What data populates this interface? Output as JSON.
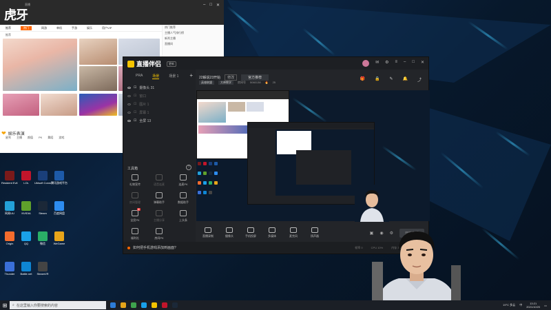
{
  "browser": {
    "logo_text": "虎牙",
    "logo_sub": "直播",
    "nav_items": [
      "推荐",
      "热门",
      "网游",
      "单机",
      "手游",
      "娱乐",
      "用户VIP"
    ],
    "sub_text": "推荐",
    "section_title": "娱乐表演",
    "section_tabs": [
      "星秀",
      "主播",
      "颜值",
      "PK",
      "舞蹈",
      "游戏"
    ],
    "right_rows": [
      "热门推荐",
      "主播人气排行榜",
      "新秀主播",
      "直播间"
    ]
  },
  "app": {
    "title": "直播伴侣",
    "version": "更新",
    "scene_tabs": [
      "PRA",
      "场景",
      "场景 1"
    ],
    "sources": [
      {
        "label": "摄像头 31",
        "dim": false
      },
      {
        "label": "窗口",
        "dim": true
      },
      {
        "label": "图片 1",
        "dim": true
      },
      {
        "label": "屏幕 1",
        "dim": true
      },
      {
        "label": "全屏 13",
        "dim": false
      }
    ],
    "tools_title": "工具箱",
    "tools_help": "?",
    "tools": [
      {
        "label": "礼物宣传",
        "dim": false
      },
      {
        "label": "语音连麦",
        "dim": true
      },
      {
        "label": "连麦PK",
        "dim": false
      },
      {
        "label": "房间管理",
        "dim": true
      },
      {
        "label": "弹幕助手",
        "dim": false
      },
      {
        "label": "数据助手",
        "dim": false
      },
      {
        "label": "全民PK",
        "dim": false,
        "tag": "新"
      },
      {
        "label": "主播分享",
        "dim": true
      },
      {
        "label": "上头条",
        "dim": false
      },
      {
        "label": "福利社",
        "dim": false
      },
      {
        "label": "房间PK",
        "dim": false
      }
    ],
    "stream_title": "22解说23开始",
    "stream_btn": "修改",
    "stream_category": "官方推荐",
    "sub_chip_1": "英雄联盟",
    "sub_chip_2": "大神教学",
    "room_label": "房间号",
    "room_no": "5060138",
    "heat": "25",
    "bottom_tools": [
      "直播录制",
      "摄像头",
      "手机投屏",
      "多媒体",
      "麦克风",
      "扬声器"
    ],
    "go_live": "开始直播",
    "footer_tip": "如何把手机游戏添加到画面?",
    "footer_stats": [
      "帧率 0",
      "CPU 10%",
      "内存 30%",
      "码率 0KB"
    ]
  },
  "desktop_icons": [
    {
      "label": "Resident Evil 5",
      "color": "#7a1a1a"
    },
    {
      "label": "LOL",
      "color": "#c2152b"
    },
    {
      "label": "Ubisoft Connect",
      "color": "#1a3f7a"
    },
    {
      "label": "腾讯游戏平台",
      "color": "#1d5aa8"
    },
    {
      "label": "网易UU",
      "color": "#23a0d8"
    },
    {
      "label": "NVIDIA",
      "color": "#5fa12b"
    },
    {
      "label": "Steam",
      "color": "#1b2838"
    },
    {
      "label": "百度网盘",
      "color": "#2d8cf0"
    },
    {
      "label": "Origin",
      "color": "#f56c2d"
    },
    {
      "label": "QQ",
      "color": "#1aa0e8"
    },
    {
      "label": "微信",
      "color": "#2aae67"
    },
    {
      "label": "WeGame",
      "color": "#e8a51a"
    },
    {
      "label": "Thunder",
      "color": "#3a6fd8"
    },
    {
      "label": "Battle.net",
      "color": "#0e86d4"
    },
    {
      "label": "SteamVR",
      "color": "#444"
    }
  ],
  "taskbar": {
    "search_placeholder": "在这里输入你要搜索的内容",
    "time": "13:21",
    "date": "2021/10/20",
    "weather": "19°C 多云",
    "lang": "中"
  },
  "colors": {
    "accent": "#f5c400",
    "brand_orange": "#ff6600",
    "app_bg": "#232529"
  }
}
